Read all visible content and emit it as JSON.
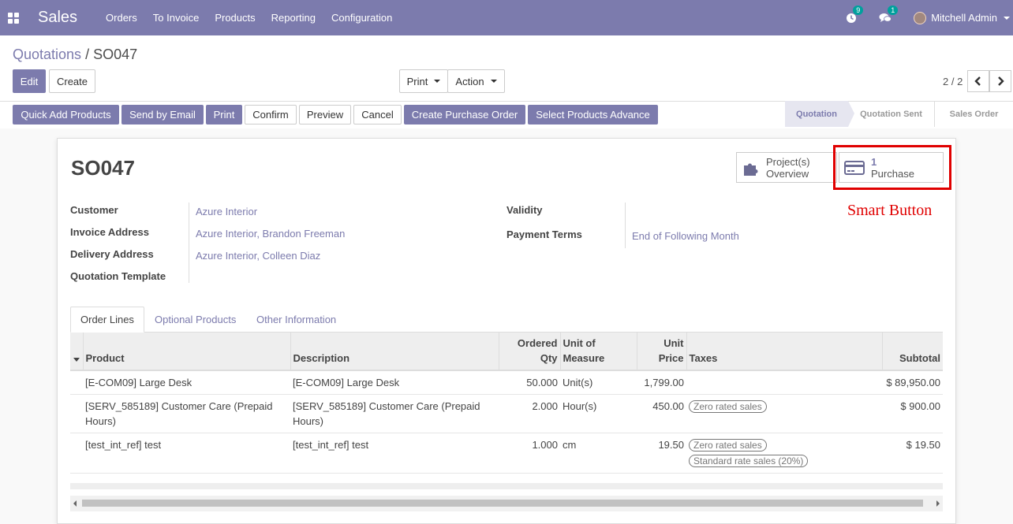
{
  "app": {
    "title": "Sales"
  },
  "menu": [
    "Orders",
    "To Invoice",
    "Products",
    "Reporting",
    "Configuration"
  ],
  "navbar": {
    "activity_count": "9",
    "message_count": "1",
    "user": "Mitchell Admin"
  },
  "breadcrumb": {
    "parent": "Quotations",
    "separator": "/",
    "current": "SO047"
  },
  "buttons": {
    "edit": "Edit",
    "create": "Create",
    "print": "Print",
    "action": "Action"
  },
  "pager": {
    "value": "2 / 2"
  },
  "header_buttons": {
    "quick_add": "Quick Add Products",
    "send_email": "Send by Email",
    "print": "Print",
    "confirm": "Confirm",
    "preview": "Preview",
    "cancel": "Cancel",
    "create_po": "Create Purchase Order",
    "select_products": "Select Products Advance"
  },
  "stages": [
    "Quotation",
    "Quotation Sent",
    "Sales Order"
  ],
  "smart_buttons": {
    "project_line1": "Project(s)",
    "project_line2": "Overview",
    "purchase_count": "1",
    "purchase_label": "Purchase"
  },
  "annotation": "Smart Button",
  "record": {
    "name": "SO047"
  },
  "fields": {
    "customer_label": "Customer",
    "customer": "Azure Interior",
    "invoice_label": "Invoice Address",
    "invoice": "Azure Interior, Brandon Freeman",
    "delivery_label": "Delivery Address",
    "delivery": "Azure Interior, Colleen Diaz",
    "template_label": "Quotation Template",
    "validity_label": "Validity",
    "payment_label": "Payment Terms",
    "payment": "End of Following Month"
  },
  "tabs": [
    "Order Lines",
    "Optional Products",
    "Other Information"
  ],
  "table": {
    "headers": {
      "product": "Product",
      "description": "Description",
      "qty_1": "Ordered",
      "qty_2": "Qty",
      "uom_1": "Unit of",
      "uom_2": "Measure",
      "price_1": "Unit",
      "price_2": "Price",
      "taxes": "Taxes",
      "subtotal": "Subtotal"
    },
    "rows": [
      {
        "product": "[E-COM09] Large Desk",
        "description": "[E-COM09] Large Desk",
        "qty": "50.000",
        "uom": "Unit(s)",
        "price": "1,799.00",
        "tax1": "",
        "tax2": "",
        "subtotal": "$ 89,950.00"
      },
      {
        "product": "[SERV_585189] Customer Care (Prepaid Hours)",
        "description": "[SERV_585189] Customer Care (Prepaid Hours)",
        "qty": "2.000",
        "uom": "Hour(s)",
        "price": "450.00",
        "tax1": "Zero rated sales",
        "tax2": "",
        "subtotal": "$ 900.00"
      },
      {
        "product": "[test_int_ref] test",
        "description": "[test_int_ref] test",
        "qty": "1.000",
        "uom": "cm",
        "price": "19.50",
        "tax1": "Zero rated sales",
        "tax2": "Standard rate sales (20%)",
        "subtotal": "$ 19.50"
      }
    ]
  }
}
